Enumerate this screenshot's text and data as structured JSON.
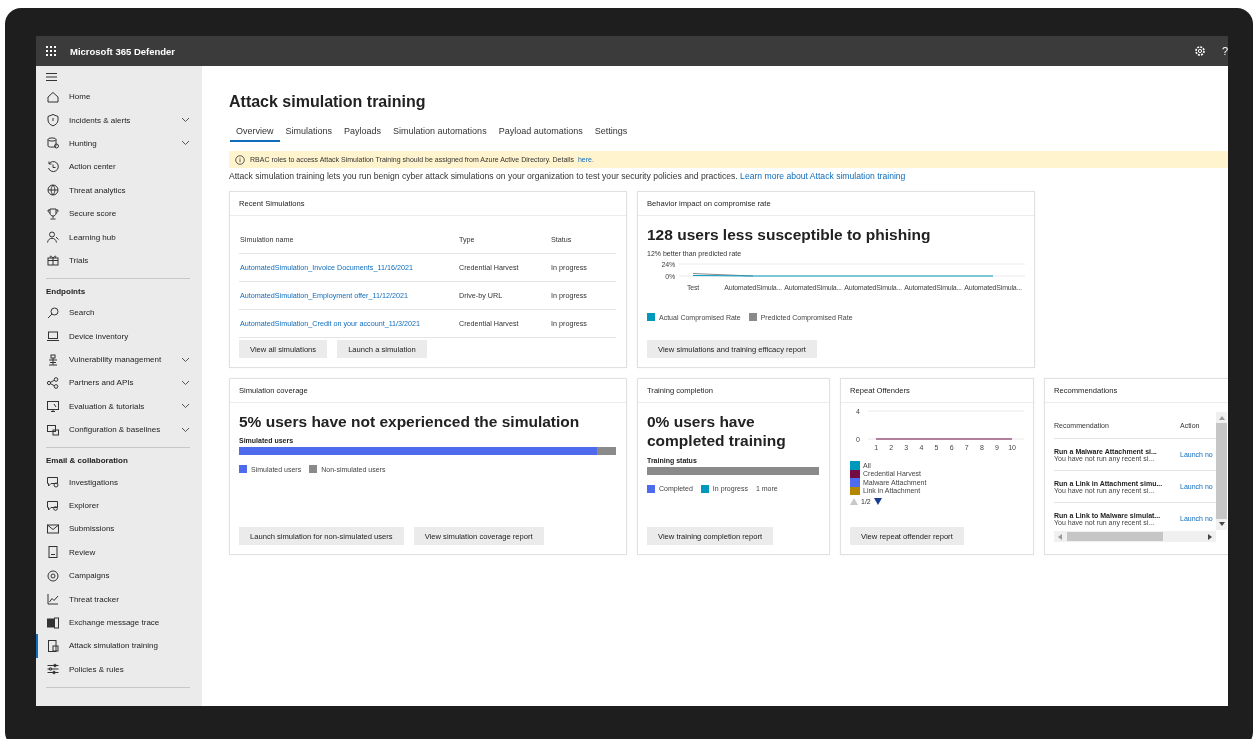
{
  "window": {
    "title": "Microsoft 365 Defender",
    "help_glyph": "?"
  },
  "sidebar": {
    "groups": [
      {
        "items": [
          {
            "label": "Home",
            "expandable": false,
            "selected": false
          },
          {
            "label": "Incidents & alerts",
            "expandable": true,
            "selected": false
          },
          {
            "label": "Hunting",
            "expandable": true,
            "selected": false
          },
          {
            "label": "Action center",
            "expandable": false,
            "selected": false
          },
          {
            "label": "Threat analytics",
            "expandable": false,
            "selected": false
          },
          {
            "label": "Secure score",
            "expandable": false,
            "selected": false
          },
          {
            "label": "Learning hub",
            "expandable": false,
            "selected": false
          },
          {
            "label": "Trials",
            "expandable": false,
            "selected": false
          }
        ]
      },
      {
        "heading": "Endpoints",
        "items": [
          {
            "label": "Search",
            "expandable": false,
            "selected": false
          },
          {
            "label": "Device inventory",
            "expandable": false,
            "selected": false
          },
          {
            "label": "Vulnerability management",
            "expandable": true,
            "selected": false
          },
          {
            "label": "Partners and APIs",
            "expandable": true,
            "selected": false
          },
          {
            "label": "Evaluation & tutorials",
            "expandable": true,
            "selected": false
          },
          {
            "label": "Configuration & baselines",
            "expandable": true,
            "selected": false
          }
        ]
      },
      {
        "heading": "Email & collaboration",
        "items": [
          {
            "label": "Investigations",
            "expandable": false,
            "selected": false
          },
          {
            "label": "Explorer",
            "expandable": false,
            "selected": false
          },
          {
            "label": "Submissions",
            "expandable": false,
            "selected": false
          },
          {
            "label": "Review",
            "expandable": false,
            "selected": false
          },
          {
            "label": "Campaigns",
            "expandable": false,
            "selected": false
          },
          {
            "label": "Threat tracker",
            "expandable": false,
            "selected": false
          },
          {
            "label": "Exchange message trace",
            "expandable": false,
            "selected": false
          },
          {
            "label": "Attack simulation training",
            "expandable": false,
            "selected": true
          },
          {
            "label": "Policies & rules",
            "expandable": false,
            "selected": false
          }
        ]
      }
    ]
  },
  "page": {
    "title": "Attack simulation training",
    "tabs": [
      {
        "label": "Overview",
        "selected": true
      },
      {
        "label": "Simulations",
        "selected": false
      },
      {
        "label": "Payloads",
        "selected": false
      },
      {
        "label": "Simulation automations",
        "selected": false
      },
      {
        "label": "Payload automations",
        "selected": false
      },
      {
        "label": "Settings",
        "selected": false
      }
    ],
    "banner": {
      "text": "RBAC roles to access Attack Simulation Training should be assigned from Azure Active Directory. Details",
      "link": "here."
    },
    "description": {
      "text": "Attack simulation training lets you run benign cyber attack simulations on your organization to test your security policies and practices.",
      "link": "Learn more about Attack simulation training"
    }
  },
  "recent_simulations": {
    "title": "Recent Simulations",
    "columns": [
      "Simulation name",
      "Type",
      "Status"
    ],
    "rows": [
      {
        "name": "AutomatedSimulation_Invoice Documents_11/16/2021",
        "type": "Credential Harvest",
        "status": "In progress"
      },
      {
        "name": "AutomatedSimulation_Employment offer_11/12/2021",
        "type": "Drive-by URL",
        "status": "In progress"
      },
      {
        "name": "AutomatedSimulation_Credit on your account_11/3/2021",
        "type": "Credential Harvest",
        "status": "In progress"
      }
    ],
    "buttons": [
      "View all simulations",
      "Launch a simulation"
    ]
  },
  "behavior_impact": {
    "title": "Behavior impact on compromise rate",
    "headline": "128 users less susceptible to phishing",
    "subtitle": "12% better than predicted rate",
    "chart_data": {
      "type": "line",
      "categories": [
        "Test",
        "AutomatedSimula...",
        "AutomatedSimula...",
        "AutomatedSimula...",
        "AutomatedSimula...",
        "AutomatedSimula..."
      ],
      "ylim": [
        0,
        24
      ],
      "yticks": [
        {
          "value": 0,
          "label": "0%"
        },
        {
          "value": 24,
          "label": "24%"
        }
      ],
      "series": [
        {
          "name": "Actual Compromised Rate",
          "color": "#0099bc",
          "values": [
            1,
            0,
            0,
            0,
            0,
            0
          ]
        },
        {
          "name": "Predicted Compromised Rate",
          "color": "#8a8a8a",
          "values": [
            5,
            0,
            null,
            null,
            null,
            null
          ]
        }
      ]
    },
    "button": "View simulations and training efficacy report"
  },
  "simulation_coverage": {
    "title": "Simulation coverage",
    "headline": "5% users have not experienced the simulation",
    "bar_label": "Simulated users",
    "level": 0.95,
    "legend": [
      {
        "label": "Simulated users",
        "color": "#4f6bed"
      },
      {
        "label": "Non-simulated users",
        "color": "#8a8a8a"
      }
    ],
    "buttons": [
      "Launch simulation for non-simulated users",
      "View simulation coverage report"
    ]
  },
  "training_completion": {
    "title": "Training completion",
    "headline": "0% users have completed training",
    "bar_label": "Training status",
    "level": 0,
    "legend": [
      {
        "label": "Completed",
        "color": "#4f6bed"
      },
      {
        "label": "In progress",
        "color": "#0099bc"
      }
    ],
    "more": "1 more",
    "button": "View training completion report"
  },
  "repeat_offenders": {
    "title": "Repeat Offenders",
    "chart_data": {
      "type": "line",
      "categories": [
        "1",
        "2",
        "3",
        "4",
        "5",
        "6",
        "7",
        "8",
        "9",
        "10"
      ],
      "ylim": [
        0,
        4
      ],
      "yticks": [
        0,
        4
      ],
      "series": [
        {
          "name": "All",
          "color": "#0099bc",
          "values": [
            null,
            null,
            null,
            null,
            null,
            null,
            null,
            null,
            null,
            null
          ]
        },
        {
          "name": "Credential Harvest",
          "color": "#750b45",
          "values": [
            0,
            0,
            0,
            0,
            0,
            0,
            0,
            0,
            0,
            0
          ]
        },
        {
          "name": "Malware Attachment",
          "color": "#4f6bed",
          "values": [
            null,
            null,
            null,
            null,
            null,
            null,
            null,
            null,
            null,
            null
          ]
        },
        {
          "name": "Link in Attachment",
          "color": "#b38800",
          "values": [
            null,
            null,
            null,
            null,
            null,
            null,
            null,
            null,
            null,
            null
          ]
        }
      ]
    },
    "pager": "1/2",
    "button": "View repeat offender report"
  },
  "recommendations": {
    "title": "Recommendations",
    "columns": [
      "Recommendation",
      "Action"
    ],
    "rows": [
      {
        "title": "Run a Malware Attachment si...",
        "detail": "You have not run any recent si...",
        "action": "Launch no"
      },
      {
        "title": "Run a Link in Attachment simu...",
        "detail": "You have not run any recent si...",
        "action": "Launch no"
      },
      {
        "title": "Run a Link to Malware simulat...",
        "detail": "You have not run any recent si...",
        "action": "Launch no"
      }
    ]
  }
}
